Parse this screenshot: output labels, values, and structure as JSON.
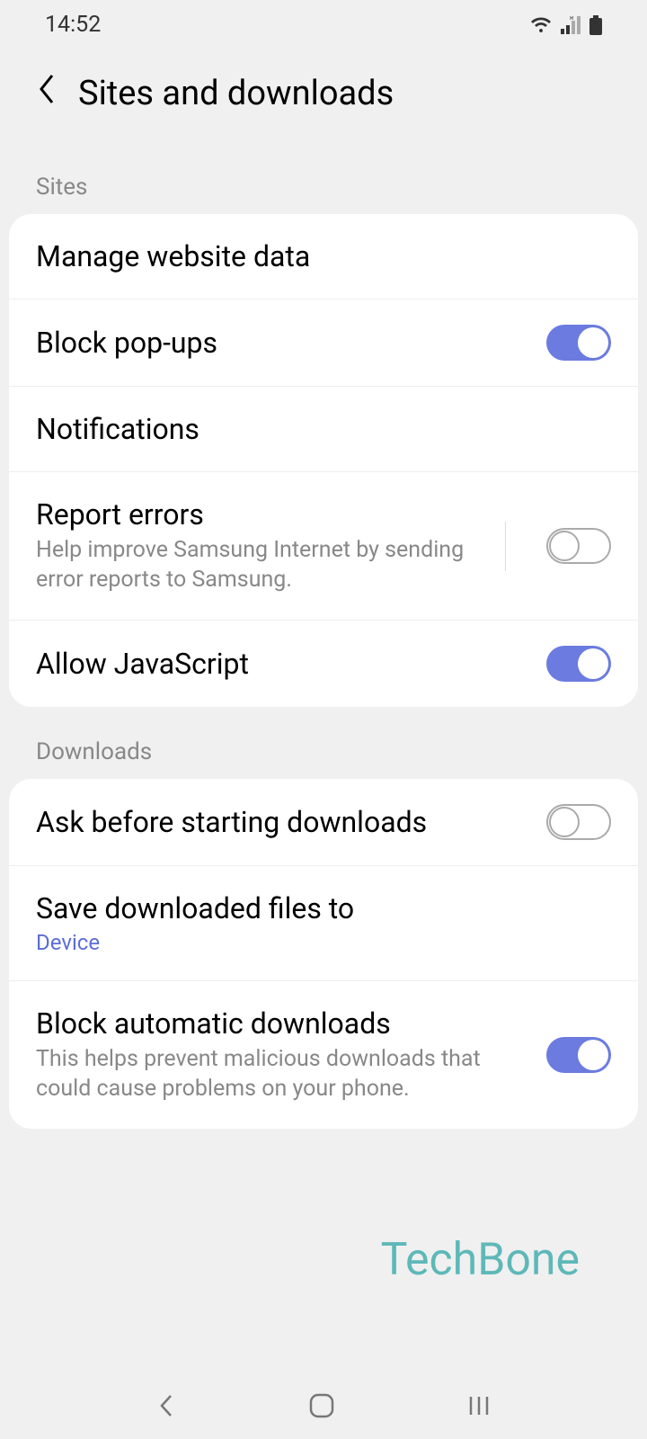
{
  "status": {
    "time": "14:52"
  },
  "header": {
    "title": "Sites and downloads"
  },
  "sections": {
    "sites": {
      "label": "Sites",
      "items": {
        "manage_data": "Manage website data",
        "block_popups": "Block pop-ups",
        "notifications": "Notifications",
        "report_errors": {
          "title": "Report errors",
          "subtitle": "Help improve Samsung Internet by sending error reports to Samsung."
        },
        "allow_js": "Allow JavaScript"
      }
    },
    "downloads": {
      "label": "Downloads",
      "items": {
        "ask_before": "Ask before starting downloads",
        "save_to": {
          "title": "Save downloaded files to",
          "value": "Device"
        },
        "block_auto": {
          "title": "Block automatic downloads",
          "subtitle": "This helps prevent malicious downloads that could cause problems on your phone."
        }
      }
    }
  },
  "toggles": {
    "block_popups": true,
    "report_errors": false,
    "allow_js": true,
    "ask_before": false,
    "block_auto": true
  },
  "watermark": "TechBone"
}
